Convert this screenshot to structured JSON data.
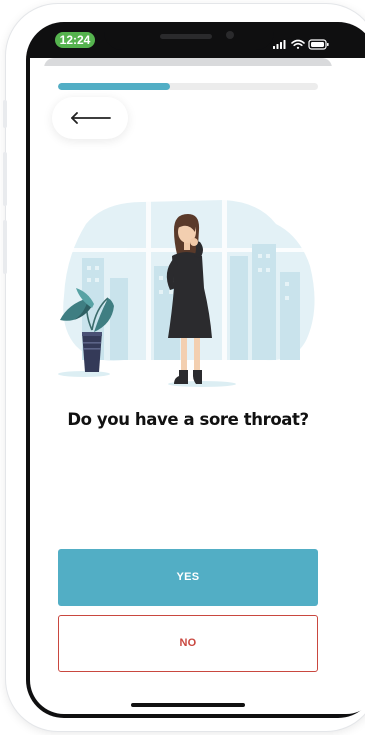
{
  "status_bar": {
    "time": "12:24",
    "time_pill_color": "#55b34e",
    "icons": [
      "signal-icon",
      "wifi-icon",
      "battery-icon"
    ]
  },
  "survey": {
    "progress": 0.43,
    "back_icon": "arrow-left-icon",
    "illustration": "woman-holding-throat-illustration",
    "question": "Do you have a sore throat?",
    "yes_label": "YES",
    "no_label": "NO"
  },
  "colors": {
    "accent": "#52aec5",
    "no_button": "#c9473f",
    "progress_track": "#ececec"
  }
}
